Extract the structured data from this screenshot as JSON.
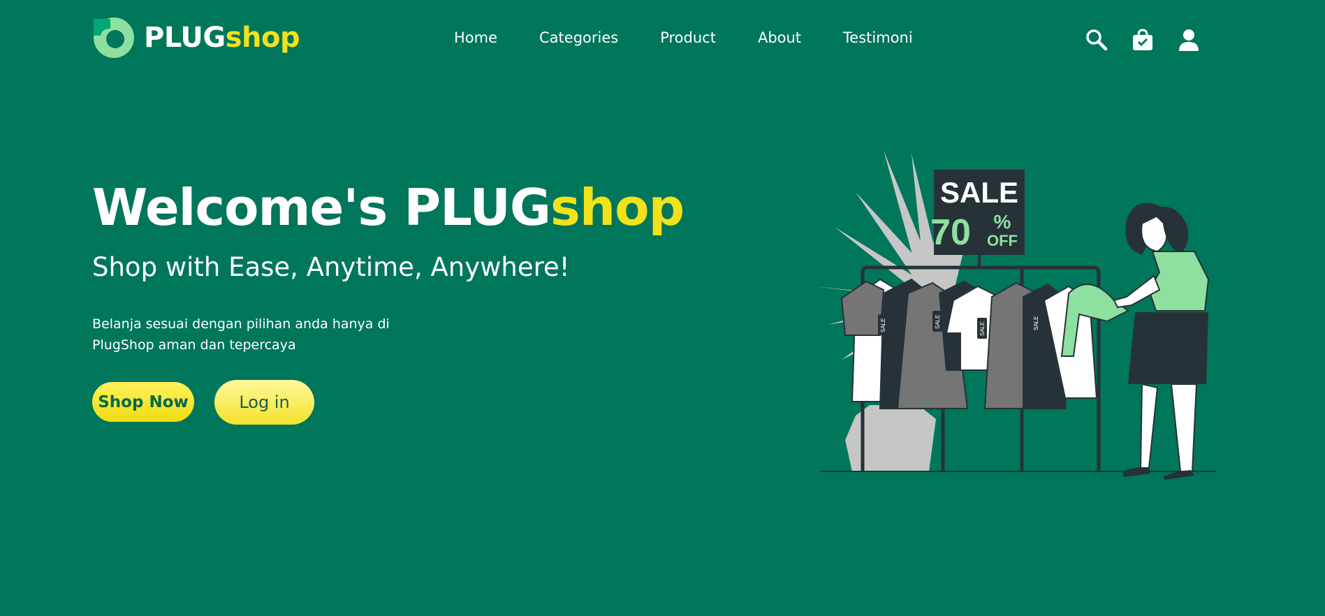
{
  "brand": {
    "name_part1": "PLUG",
    "name_part2": "shop",
    "colors": {
      "background": "#00765a",
      "accent_yellow": "#f2e21a",
      "accent_light_green": "#8ee0a0"
    }
  },
  "nav": {
    "items": [
      {
        "label": "Home"
      },
      {
        "label": "Categories"
      },
      {
        "label": "Product"
      },
      {
        "label": "About"
      },
      {
        "label": "Testimoni"
      }
    ]
  },
  "header_icons": [
    "search-icon",
    "shopping-bag-icon",
    "user-icon"
  ],
  "hero": {
    "title_part1": "Welcome's PLUG",
    "title_part2": "shop",
    "subtitle": "Shop with Ease, Anytime, Anywhere!",
    "description": "Belanja sesuai dengan pilihan anda hanya di PlugShop aman dan tepercaya",
    "shop_button": "Shop Now",
    "login_button": "Log in"
  },
  "illustration": {
    "sign_title": "SALE",
    "sign_percent": "70",
    "sign_percent_symbol": "%",
    "sign_off": "OFF",
    "tag_text": "SALE"
  }
}
